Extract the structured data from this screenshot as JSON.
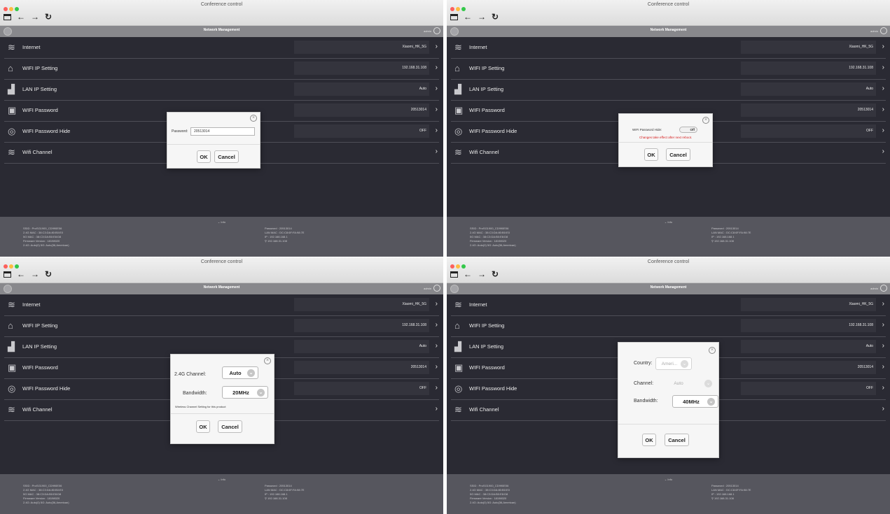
{
  "window": {
    "title": "Conference control"
  },
  "header": {
    "title": "Network Management",
    "user": "admin"
  },
  "rows": [
    {
      "label": "Internet",
      "value": "Xiaomi_HK_5G",
      "icon": "wifi-icon"
    },
    {
      "label": "WIFI IP Setting",
      "value": "192.168.31.108",
      "icon": "router-icon"
    },
    {
      "label": "LAN IP Setting",
      "value": "Auto",
      "icon": "lan-icon"
    },
    {
      "label": "WIFI Password",
      "value": "20513014",
      "icon": "lock-icon"
    },
    {
      "label": "WIFI Password Hide",
      "value": "OFF",
      "icon": "eye-icon"
    },
    {
      "label": "Wifi Channel",
      "value": "",
      "icon": "wifi-icon"
    }
  ],
  "footer": {
    "toggle": "Info",
    "left": [
      "SSID : ProSG1900_CD990E06",
      "2.4G MAC : 38:C3:DA:80:B0:E0",
      "5G MAC : 38:C3:DA:B0:E8:D8",
      "Firmware Version : 18198020",
      "2.4G: Auto(0)   5G: Auto(36,American)"
    ],
    "right": [
      "Password : 20513014",
      "LAN MAC : DC:C8:6F:FA:98:7E",
      "IP : 192.168.168.1",
      "192.168.31.108"
    ]
  },
  "dialogs": {
    "password": {
      "label": "Password:",
      "value": "20513014",
      "ok": "OK",
      "cancel": "Cancel"
    },
    "hide": {
      "label": "WIFI Password Hide:",
      "toggle": "Off",
      "warning": "Changes take effect after next reboot.",
      "ok": "OK",
      "cancel": "Cancel"
    },
    "channel": {
      "channel_label": "2.4G Channel:",
      "channel_value": "Auto",
      "bandwidth_label": "Bandwidth:",
      "bandwidth_value": "20MHz",
      "note": "Wireless Channel Setting for this product",
      "ok": "OK",
      "cancel": "Cancel"
    },
    "channel5g": {
      "country_label": "Country:",
      "country_value": "Ameri...",
      "channel_label": "Channel:",
      "channel_value": "Auto",
      "bandwidth_label": "Bandwidth:",
      "bandwidth_value": "40MHz",
      "ok": "OK",
      "cancel": "Cancel"
    }
  }
}
